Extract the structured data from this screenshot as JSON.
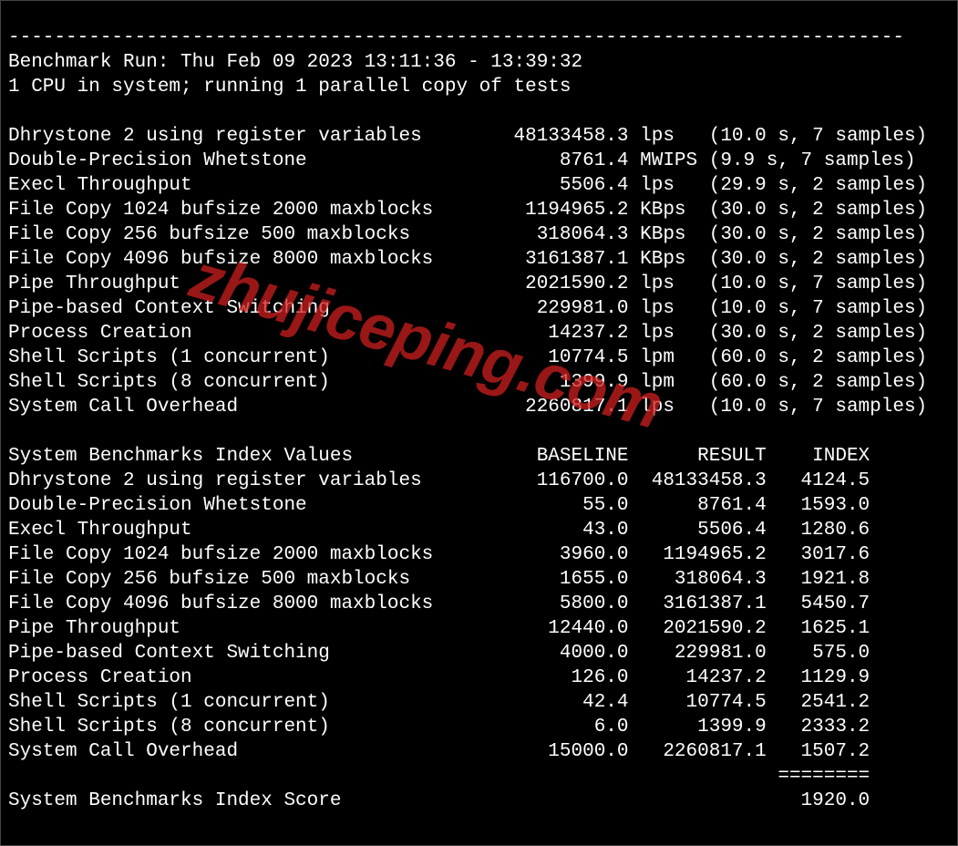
{
  "divider": "------------------------------------------------------------------------------",
  "run_line": "Benchmark Run: Thu Feb 09 2023 13:11:36 - 13:39:32",
  "cpu_line": "1 CPU in system; running 1 parallel copy of tests",
  "tests": [
    {
      "name": "Dhrystone 2 using register variables",
      "value": "48133458.3",
      "unit": "lps",
      "detail": "(10.0 s, 7 samples)"
    },
    {
      "name": "Double-Precision Whetstone",
      "value": "8761.4",
      "unit": "MWIPS",
      "detail": "(9.9 s, 7 samples)"
    },
    {
      "name": "Execl Throughput",
      "value": "5506.4",
      "unit": "lps",
      "detail": "(29.9 s, 2 samples)"
    },
    {
      "name": "File Copy 1024 bufsize 2000 maxblocks",
      "value": "1194965.2",
      "unit": "KBps",
      "detail": "(30.0 s, 2 samples)"
    },
    {
      "name": "File Copy 256 bufsize 500 maxblocks",
      "value": "318064.3",
      "unit": "KBps",
      "detail": "(30.0 s, 2 samples)"
    },
    {
      "name": "File Copy 4096 bufsize 8000 maxblocks",
      "value": "3161387.1",
      "unit": "KBps",
      "detail": "(30.0 s, 2 samples)"
    },
    {
      "name": "Pipe Throughput",
      "value": "2021590.2",
      "unit": "lps",
      "detail": "(10.0 s, 7 samples)"
    },
    {
      "name": "Pipe-based Context Switching",
      "value": "229981.0",
      "unit": "lps",
      "detail": "(10.0 s, 7 samples)"
    },
    {
      "name": "Process Creation",
      "value": "14237.2",
      "unit": "lps",
      "detail": "(30.0 s, 2 samples)"
    },
    {
      "name": "Shell Scripts (1 concurrent)",
      "value": "10774.5",
      "unit": "lpm",
      "detail": "(60.0 s, 2 samples)"
    },
    {
      "name": "Shell Scripts (8 concurrent)",
      "value": "1399.9",
      "unit": "lpm",
      "detail": "(60.0 s, 2 samples)"
    },
    {
      "name": "System Call Overhead",
      "value": "2260817.1",
      "unit": "lps",
      "detail": "(10.0 s, 7 samples)"
    }
  ],
  "index_header": {
    "title": "System Benchmarks Index Values",
    "baseline": "BASELINE",
    "result": "RESULT",
    "index": "INDEX"
  },
  "index_rows": [
    {
      "name": "Dhrystone 2 using register variables",
      "baseline": "116700.0",
      "result": "48133458.3",
      "index": "4124.5"
    },
    {
      "name": "Double-Precision Whetstone",
      "baseline": "55.0",
      "result": "8761.4",
      "index": "1593.0"
    },
    {
      "name": "Execl Throughput",
      "baseline": "43.0",
      "result": "5506.4",
      "index": "1280.6"
    },
    {
      "name": "File Copy 1024 bufsize 2000 maxblocks",
      "baseline": "3960.0",
      "result": "1194965.2",
      "index": "3017.6"
    },
    {
      "name": "File Copy 256 bufsize 500 maxblocks",
      "baseline": "1655.0",
      "result": "318064.3",
      "index": "1921.8"
    },
    {
      "name": "File Copy 4096 bufsize 8000 maxblocks",
      "baseline": "5800.0",
      "result": "3161387.1",
      "index": "5450.7"
    },
    {
      "name": "Pipe Throughput",
      "baseline": "12440.0",
      "result": "2021590.2",
      "index": "1625.1"
    },
    {
      "name": "Pipe-based Context Switching",
      "baseline": "4000.0",
      "result": "229981.0",
      "index": "575.0"
    },
    {
      "name": "Process Creation",
      "baseline": "126.0",
      "result": "14237.2",
      "index": "1129.9"
    },
    {
      "name": "Shell Scripts (1 concurrent)",
      "baseline": "42.4",
      "result": "10774.5",
      "index": "2541.2"
    },
    {
      "name": "Shell Scripts (8 concurrent)",
      "baseline": "6.0",
      "result": "1399.9",
      "index": "2333.2"
    },
    {
      "name": "System Call Overhead",
      "baseline": "15000.0",
      "result": "2260817.1",
      "index": "1507.2"
    }
  ],
  "index_sep": "                                                                   ========",
  "score_label": "System Benchmarks Index Score",
  "score_value": "1920.0",
  "watermark": "zhujiceping.com"
}
